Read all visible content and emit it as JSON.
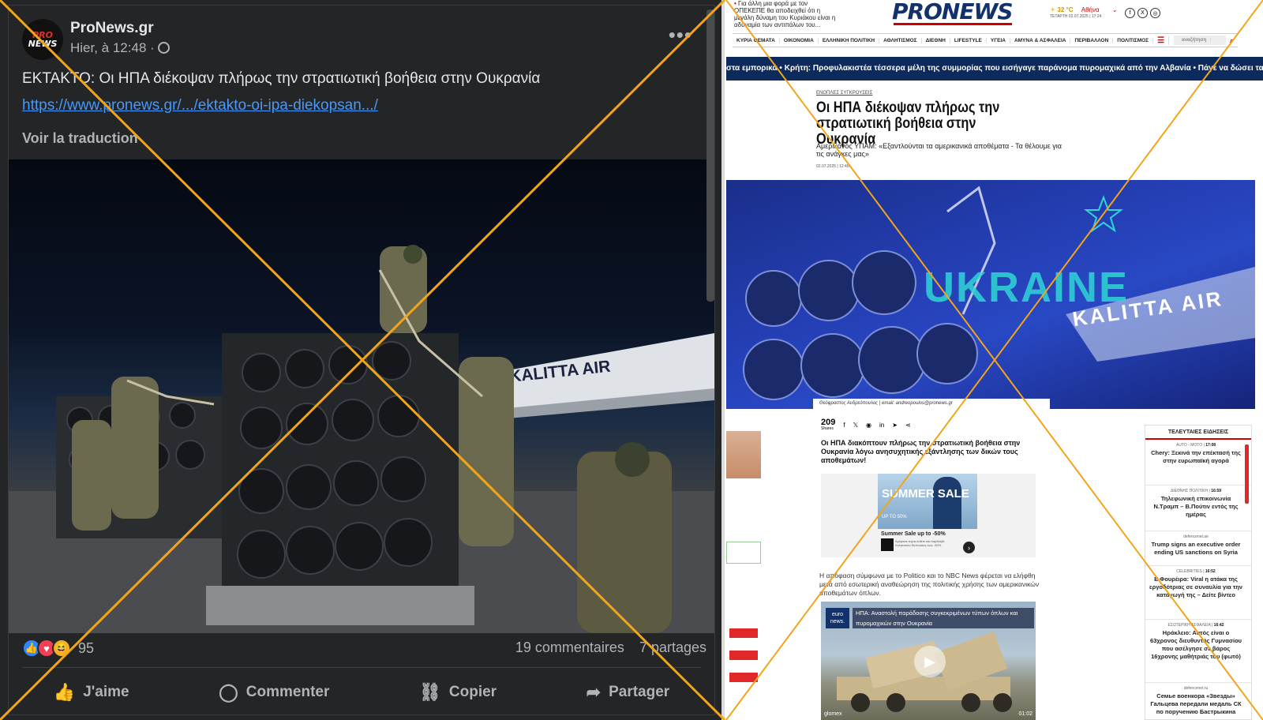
{
  "fb": {
    "avatar": {
      "line1": "PRO",
      "line2": "NEWS"
    },
    "page_name": "ProNews.gr",
    "time": "Hier, à 12:48 ·",
    "more": "•••",
    "post_text": "ΕΚΤΑΚΤΟ: Οι ΗΠΑ διέκοψαν πλήρως την στρατιωτική βοήθεια στην Ουκρανία",
    "link": "https://www.pronews.gr/.../ektakto-oi-ipa-diekopsan.../",
    "translate": "Voir la traduction",
    "reaction_count": "95",
    "comments": "19 commentaires",
    "shares": "7 partages",
    "actions": {
      "like": "J'aime",
      "comment": "Commenter",
      "copy": "Copier",
      "share": "Partager"
    },
    "photo_plane_text": "KALITTA AIR"
  },
  "pn": {
    "top_ticker": "Για άλλη μια φορά με τον ΟΠΕΚΕΠΕ θα αποδειχθεί ότι η μεγάλη δύναμη του Κυριάκου είναι η αδυναμία των αντιπάλων του...",
    "logo": "PRONEWS",
    "weather": {
      "temp": "32 °C",
      "city": "Αθήνα",
      "date": "ΤΕΤΑΡΤΗ 02.07.2025 | 17:24"
    },
    "nav": [
      "ΚΥΡΙΑ ΘΕΜΑΤΑ",
      "ΟΙΚΟΝΟΜΙΑ",
      "ΕΛΛΗΝΙΚΗ ΠΟΛΙΤΙΚΗ",
      "ΑΘΛΗΤΙΣΜΟΣ",
      "ΔΙΕΘΝΗ",
      "LIFESTYLE",
      "ΥΓΕΙΑ",
      "ΑΜΥΝΑ & ΑΣΦΑΛΕΙΑ",
      "ΠΕΡΙΒΑΛΛΟΝ",
      "ΠΟΛΙΤΙΣΜΟΣ"
    ],
    "search_placeholder": "αναζήτηση",
    "banner": "στα εμπορικά • Κρήτη: Προφυλακιστέα τέσσερα μέλη της συμμορίας που εισήγαγε παράνομα πυρομαχικά από την Αλβανία • Πάγε να δώσει τα «πυρά» στα Αι",
    "category": "ΕΝΟΠΛΕΣ ΣΥΓΚΡΟΥΣΕΙΣ",
    "title": "Οι ΗΠΑ διέκοψαν πλήρως την στρατιωτική βοήθεια στην Ουκρανία",
    "subtitle": "Αμερικανός ΥΠΑΜ: «Εξαντλούνται τα αμερικανικά αποθέματα - Τα θέλουμε για τις ανάγκες μας»",
    "date": "02.07.2025 | 12:46",
    "hero_word": "UKRAINE",
    "hero_plane": "KALITTA AIR",
    "author": "Θεόφραστος Ανδρεόπουλος | email: andreopoulos@pronews.gr",
    "share_count": "209",
    "share_label": "Shares",
    "lead": "Οι ΗΠΑ διακόπτουν πλήρως την στρατιωτική βοήθεια στην Ουκρανία λόγω ανησυχητικής εξάντλησης των δικών τους αποθεμάτων!",
    "ad": {
      "sale": "SUMMER SALE",
      "upto": "UP TO 50%",
      "title": "Summer Sale up to -50%",
      "small": "Αγόρασε τώρα online και παρέλαβε Κολεκτσιόν Εκπτώσεις έως -50%"
    },
    "body": "Η απόφαση σύμφωνα με το Politico και το NBC News φέρεται να ελήφθη μετά από εσωτερική αναθεώρηση της πολιτικής χρήσης των αμερικανικών αποθεμάτων όπλων.",
    "video": {
      "logo": "euro news.",
      "title": "ΗΠΑ: Αναστολή παράδοσης συγκεκριμένων τύπων όπλων και πυρομαχικών στην Ουκρανία",
      "time": "01:02",
      "brand": "glomex"
    },
    "sidebar_title": "ΤΕΛΕΥΤΑΙΕΣ ΕΙΔΗΣΕΙΣ",
    "sidebar": [
      {
        "cat": "AUTO - MOTO",
        "time": "17:08",
        "title": "Chery: Ξεκινά την επέκτασή της στην ευρωπαϊκή αγορά"
      },
      {
        "cat": "ΔΙΕΘΝΗΣ ΠΟΛΙΤΙΚΗ",
        "time": "16:59",
        "title": "Τηλεφωνική επικοινωνία Ν.Τραμπ – Β.Πούτιν εντός της ημέρας"
      },
      {
        "cat": "defencenet.ae",
        "time": "",
        "title": "Trump signs an executive order ending US sanctions on Syria"
      },
      {
        "cat": "CELEBRITIES",
        "time": "16:52",
        "title": "Ε.Φουρέιρα: Viral η ατάκα της εργοδότριας σε συναυλία για την καταγωγή της – Δείτε βίντεο"
      },
      {
        "cat": "ΕΣΩΤΕΡΙΚΗ ΑΣΦΑΛΕΙΑ",
        "time": "16:42",
        "title": "Ηράκλειο: Αυτός είναι ο 63χρονος διευθυντής Γυμνασίου που ασέλγησε σε βάρος 16χρονης μαθήτριάς του (φωτό)"
      },
      {
        "cat": "defencenet.ru",
        "time": "",
        "title": "Семье военкора «Звезды» Гальцева передали медаль СК по поручению Бастрыкина"
      }
    ],
    "colors": {
      "navy": "#0d2a5c",
      "red": "#c00000",
      "teal": "#2ed6d6"
    }
  },
  "overlay": {
    "color": "#f2a51a"
  }
}
